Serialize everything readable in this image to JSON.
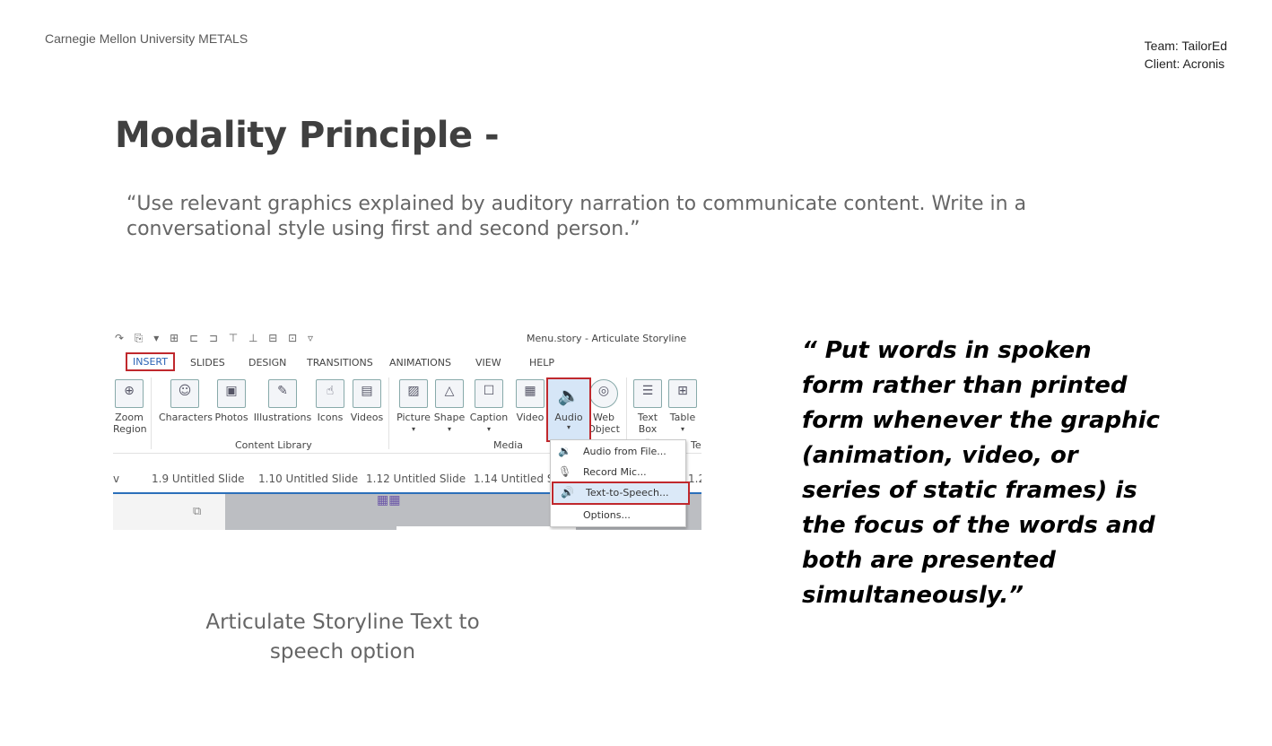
{
  "header": {
    "org": "Carnegie Mellon University METALS",
    "team": "Team: TailorEd",
    "client": "Client: Acronis"
  },
  "title": "Modality Principle -",
  "quote": "“Use relevant graphics explained by auditory narration to communicate content. Write in a conversational style using first and second person.”",
  "right_quote": "“ Put words in spoken form rather than printed form whenever the graphic (animation, video, or series of static frames) is the focus of the words and both are presented simultaneously.”",
  "caption": "Articulate Storyline Text to speech option",
  "screenshot": {
    "window_title": "Menu.story - Articulate Storyline",
    "tabs": [
      "INSERT",
      "SLIDES",
      "DESIGN",
      "TRANSITIONS",
      "ANIMATIONS",
      "VIEW",
      "HELP"
    ],
    "buttons": {
      "zoom": "Zoom\nRegion",
      "characters": "Characters",
      "photos": "Photos",
      "illustrations": "Illustrations",
      "icons": "Icons",
      "videos": "Videos",
      "picture": "Picture",
      "shape": "Shape",
      "caption": "Caption",
      "video": "Video",
      "audio": "Audio",
      "web_object": "Web\nObject",
      "text_box": "Text\nBox",
      "table": "Table"
    },
    "groups": {
      "content_library": "Content Library",
      "media": "Media",
      "text": "Te"
    },
    "slides": [
      "v",
      "1.9 Untitled Slide",
      "1.10 Untitled Slide",
      "1.12 Untitled Slide",
      "1.14 Untitled S",
      "1.2"
    ],
    "menu": {
      "audio_from_file": "Audio from File...",
      "record_mic": "Record Mic...",
      "text_to_speech": "Text-to-Speech...",
      "options": "Options..."
    },
    "accent": "#c0282d"
  }
}
